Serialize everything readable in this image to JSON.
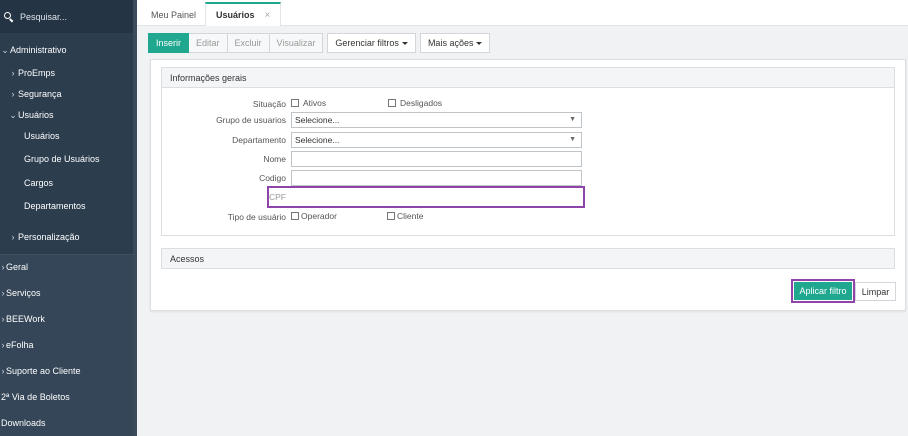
{
  "sidebar": {
    "search_placeholder": "Pesquisar...",
    "items": [
      {
        "label": "Administrativo",
        "chevron": "⌄"
      },
      {
        "label": "ProEmps",
        "chevron": "›"
      },
      {
        "label": "Segurança",
        "chevron": "›"
      },
      {
        "label": "Usuários",
        "chevron": "⌄"
      },
      {
        "label": "Usuários"
      },
      {
        "label": "Grupo de Usuários"
      },
      {
        "label": "Cargos"
      },
      {
        "label": "Departamentos"
      },
      {
        "label": "Personalização",
        "chevron": "›"
      },
      {
        "label": "Geral",
        "chevron": "›"
      },
      {
        "label": "Serviços",
        "chevron": "›"
      },
      {
        "label": "BEEWork",
        "chevron": "›"
      },
      {
        "label": "eFolha",
        "chevron": "›"
      },
      {
        "label": "Suporte ao Cliente",
        "chevron": "›"
      },
      {
        "label": "2ª Via de Boletos"
      },
      {
        "label": "Downloads"
      }
    ]
  },
  "tabs": [
    {
      "label": "Meu Painel"
    },
    {
      "label": "Usuários",
      "close": "×"
    }
  ],
  "toolbar": {
    "insert": "Inserir",
    "edit": "Editar",
    "delete": "Excluir",
    "view": "Visualizar",
    "manage_filters": "Gerenciar filtros",
    "more_actions": "Mais ações"
  },
  "form": {
    "section_general": "Informações gerais",
    "situacao_label": "Situação",
    "ativos": "Ativos",
    "desligados": "Desligados",
    "grupo_label": "Grupo de usuarios",
    "grupo_value": "Selecione...",
    "departamento_label": "Departamento",
    "departamento_value": "Selecione...",
    "nome_label": "Nome",
    "codigo_label": "Codigo",
    "cpf_label": "CPF",
    "tipo_label": "Tipo de usuário",
    "operador": "Operador",
    "cliente": "Cliente",
    "section_access": "Acessos",
    "select_arrow": "▼"
  },
  "actions": {
    "apply": "Aplicar filtro",
    "clear": "Limpar"
  },
  "colors": {
    "accent": "#1fa88f",
    "highlight": "#8e44a8",
    "sidebar": "#2c3d4e"
  }
}
